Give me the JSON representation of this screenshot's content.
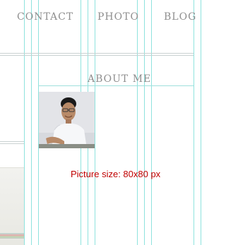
{
  "nav": {
    "items": [
      {
        "label": "CONTACT"
      },
      {
        "label": "PHOTO"
      },
      {
        "label": "BLOG"
      }
    ]
  },
  "about": {
    "title": "ABOUT ME",
    "picture_note": "Picture size: 80x80 px"
  },
  "colors": {
    "guide_lines": "#8fe3de",
    "nav_text": "#8f8f8f",
    "picture_note": "#c00000",
    "divider": "#c9d1d1"
  },
  "icons": {
    "profile_photo": "profile-photo"
  }
}
